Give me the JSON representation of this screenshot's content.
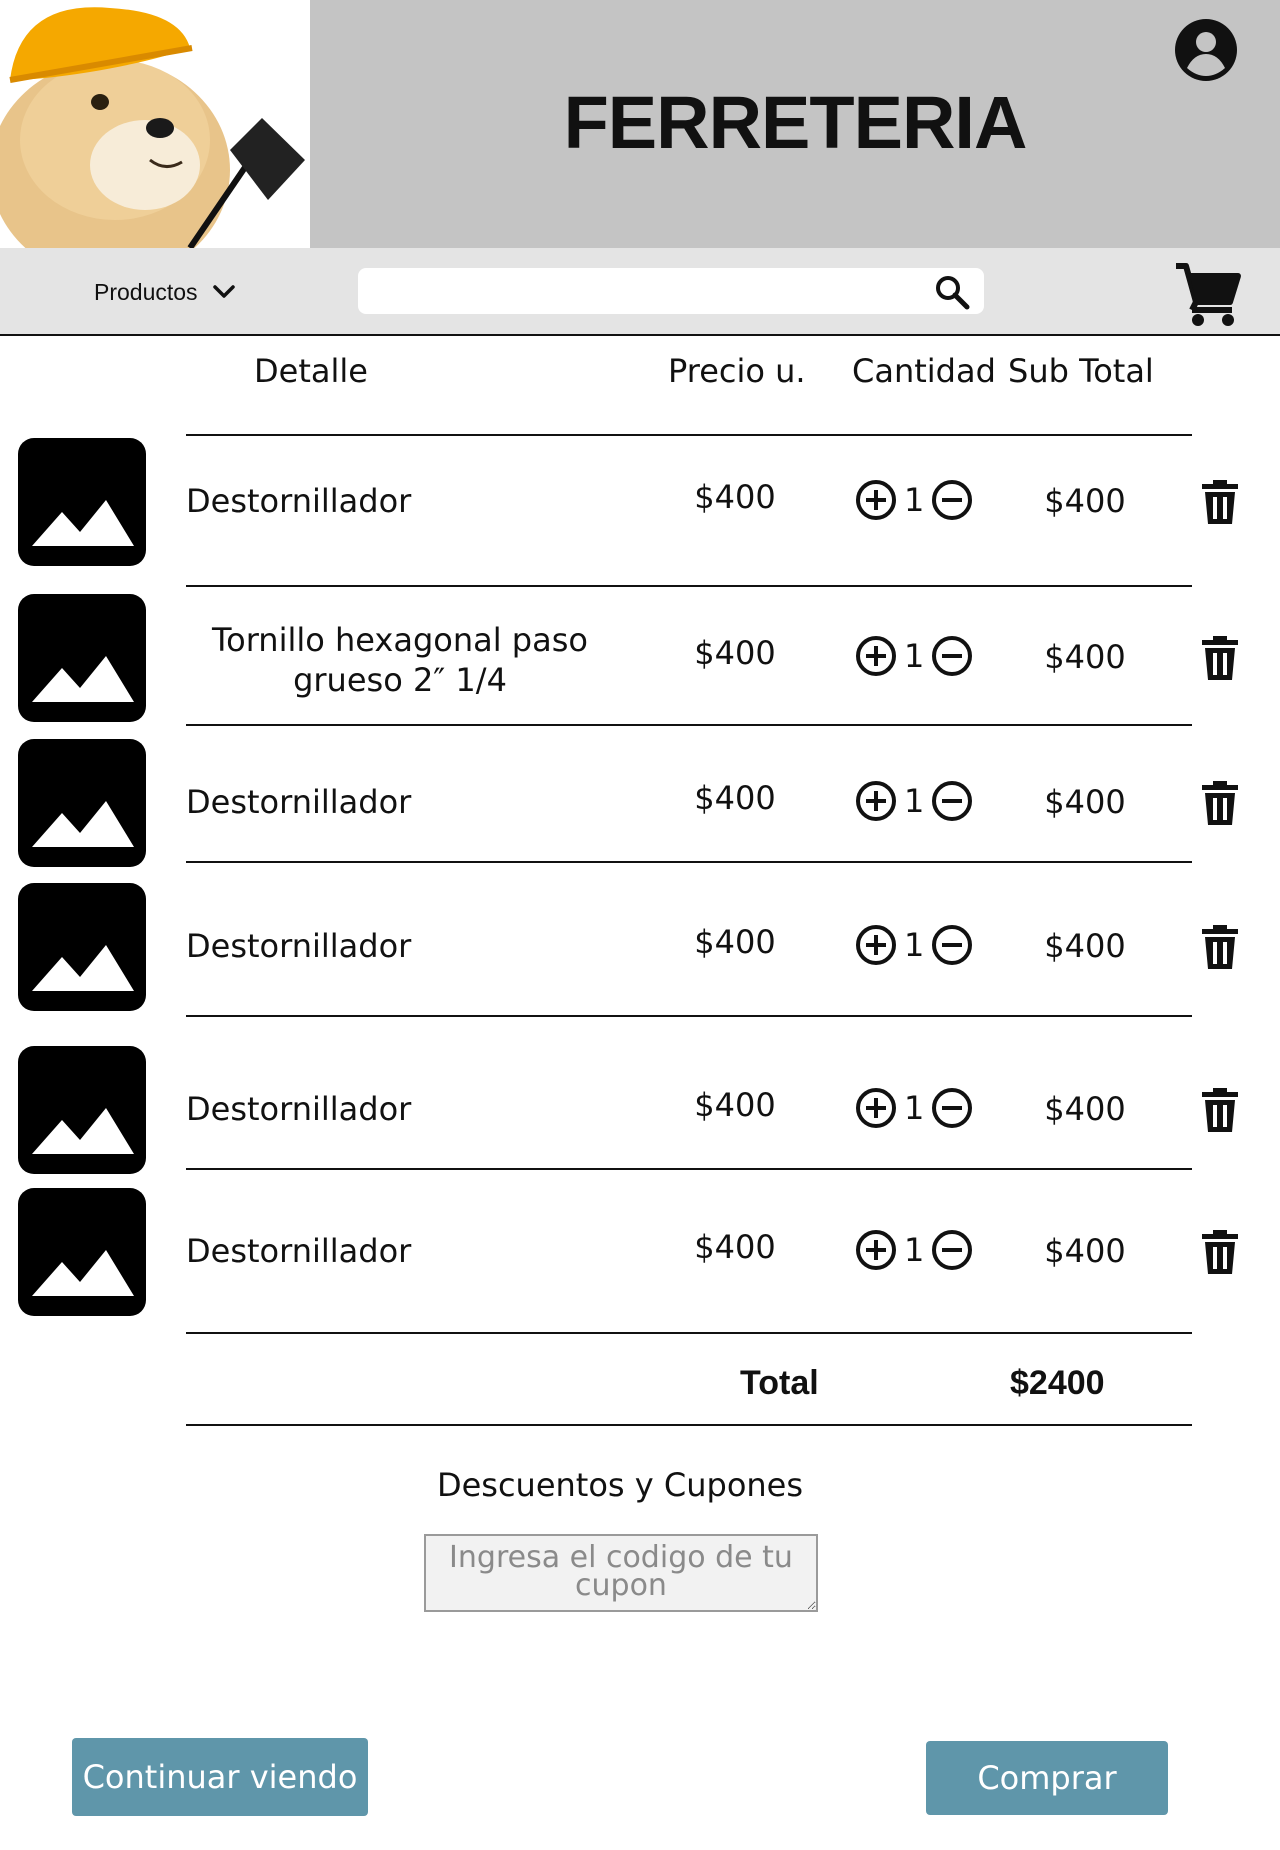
{
  "header": {
    "title": "FERRETERIA",
    "account_icon": "account-circle-icon",
    "logo": "doge-hardhat-shovel-logo"
  },
  "nav": {
    "products_label": "Productos",
    "search_placeholder": "",
    "search_icon": "search-icon",
    "cart_icon": "cart-icon"
  },
  "table": {
    "headers": {
      "detail": "Detalle",
      "unit_price": "Precio u.",
      "quantity": "Cantidad",
      "subtotal": "Sub Total"
    },
    "rows": [
      {
        "name": "Destornillador",
        "price": "$400",
        "qty": "1",
        "subtotal": "$400"
      },
      {
        "name": "Tornillo hexagonal paso grueso 2″ 1/4",
        "price": "$400",
        "qty": "1",
        "subtotal": "$400"
      },
      {
        "name": "Destornillador",
        "price": "$400",
        "qty": "1",
        "subtotal": "$400"
      },
      {
        "name": "Destornillador",
        "price": "$400",
        "qty": "1",
        "subtotal": "$400"
      },
      {
        "name": "Destornillador",
        "price": "$400",
        "qty": "1",
        "subtotal": "$400"
      },
      {
        "name": "Destornillador",
        "price": "$400",
        "qty": "1",
        "subtotal": "$400"
      }
    ],
    "total_label": "Total",
    "total_value": "$2400"
  },
  "coupons": {
    "title": "Descuentos y Cupones",
    "placeholder": "Ingresa el codigo de tu cupon"
  },
  "actions": {
    "continue_label": "Continuar viendo",
    "buy_label": "Comprar"
  },
  "colors": {
    "header_bg": "#c4c4c4",
    "nav_bg": "#e4e4e4",
    "button_bg": "#5f96aa"
  }
}
